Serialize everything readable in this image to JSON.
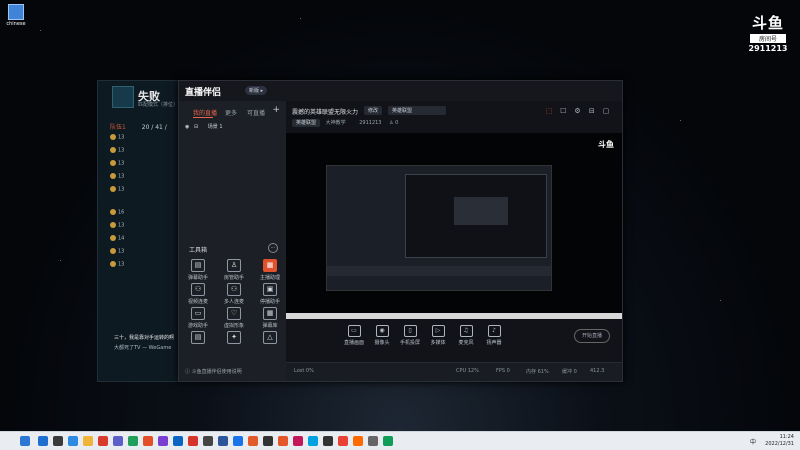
{
  "desktop": {
    "icon_label": "chinese"
  },
  "watermark": {
    "logo": "斗鱼",
    "room_label": "房间号",
    "room_number": "2911213"
  },
  "game": {
    "title": "失败",
    "subtitle": "匹配模式（排位）",
    "team_header": "队伍1",
    "kda": "20 / 41 /",
    "rows": [
      "13",
      "13",
      "13",
      "13",
      "13",
      "16",
      "13",
      "14",
      "13",
      "13"
    ],
    "chat_line": "三十，我是靠对手运转的啊",
    "chat_line2": "大都死了TV — WeGame"
  },
  "app": {
    "brand": "直播伴侣",
    "brand_badge": "新版 ▸",
    "window_buttons": [
      "—",
      "▢",
      "✕"
    ],
    "top_icons": [
      "⬚",
      "☐",
      "⚙",
      "⊟",
      "▢"
    ],
    "tabs": [
      "我的直播",
      "更多",
      "可直播"
    ],
    "add_scene": "+",
    "scene_name": "场景 1",
    "tools_header": "工具箱",
    "tools_more": "⋯",
    "tools": [
      {
        "label": "弹幕助手",
        "glyph": "▤",
        "red": false
      },
      {
        "label": "房管助手",
        "glyph": "♙",
        "red": false
      },
      {
        "label": "主播助理",
        "glyph": "▦",
        "red": true
      },
      {
        "label": "视频连麦",
        "glyph": "⚇",
        "red": false
      },
      {
        "label": "多人连麦",
        "glyph": "⚇",
        "red": false
      },
      {
        "label": "停播助手",
        "glyph": "▣",
        "red": false
      },
      {
        "label": "游戏助手",
        "glyph": "▭",
        "red": false
      },
      {
        "label": "虚拟形象",
        "glyph": "♡",
        "red": false
      },
      {
        "label": "弹幕库",
        "glyph": "▦",
        "red": false
      },
      {
        "label": "",
        "glyph": "▤",
        "red": false
      },
      {
        "label": "",
        "glyph": "✦",
        "red": false
      },
      {
        "label": "",
        "glyph": "△",
        "red": false
      }
    ],
    "bottom_note": "斗鱼直播伴侣使用说明",
    "stream_title": "震撼的英雄联盟无限火力",
    "edit_chip": "修改",
    "category_chip": "英雄联盟",
    "room_info_prefix": "英雄联盟",
    "room_info_area": "大神教学",
    "room_info_id": "2911213",
    "room_info_viewers": "0",
    "preview_watermark": "斗鱼",
    "controls": [
      {
        "label": "直播画面",
        "glyph": "▭"
      },
      {
        "label": "摄像头",
        "glyph": "◉"
      },
      {
        "label": "手机投屏",
        "glyph": "▯"
      },
      {
        "label": "多媒体",
        "glyph": "▷"
      },
      {
        "label": "麦克风",
        "glyph": "♫"
      },
      {
        "label": "扬声器",
        "glyph": "♪"
      }
    ],
    "start_button": "开始直播",
    "status": [
      "Lost 0%",
      "CPU 12%",
      "FPS 0",
      "内存 61%",
      "缓冲 0"
    ],
    "status_right": "412.3"
  },
  "taskbar": {
    "lang": "中",
    "time": "11:24",
    "date": "2022/12/31"
  }
}
